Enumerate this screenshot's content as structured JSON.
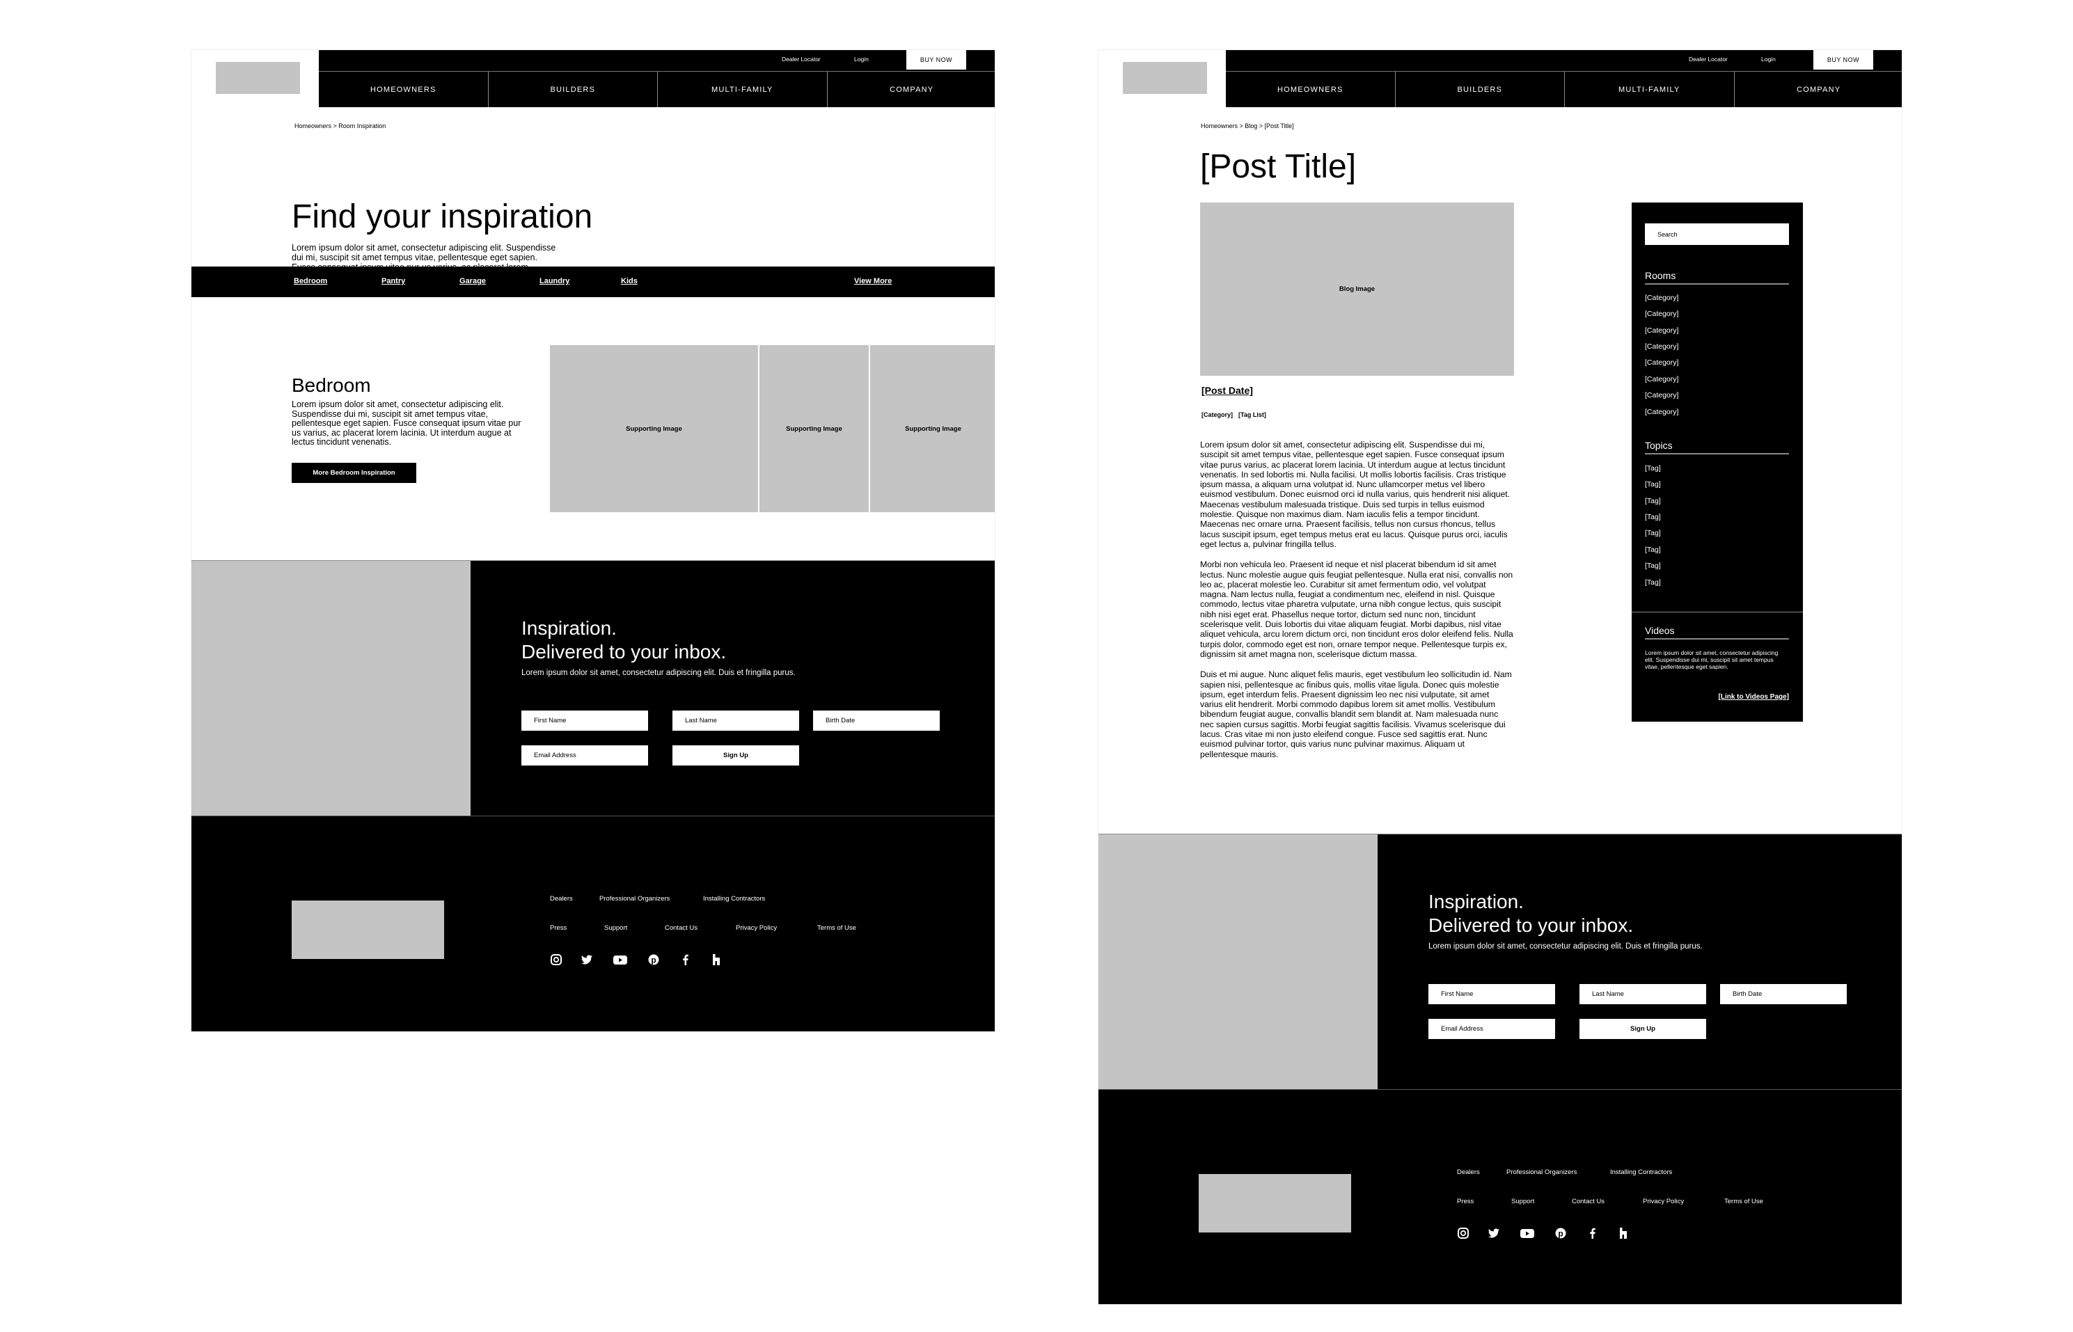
{
  "header": {
    "utility": {
      "dealer_locator": "Dealer Locator",
      "login": "Login",
      "buy_now": "BUY NOW"
    },
    "nav": [
      "HOMEOWNERS",
      "BUILDERS",
      "MULTI-FAMILY",
      "COMPANY"
    ]
  },
  "inspiration_page": {
    "breadcrumb": "Homeowners > Room Inspiration",
    "title": "Find your inspiration",
    "intro": "Lorem ipsum dolor sit amet, consectetur adipiscing elit. Suspendisse dui mi, suscipit sit amet tempus vitae, pellentesque eget sapien. Fusce consequat ipsum vitae pur us varius, ac placerat lorem lacinia. Ut interdum augue at lectus tincidunt venenatis.",
    "categories": [
      "Bedroom",
      "Pantry",
      "Garage",
      "Laundry",
      "Kids"
    ],
    "view_more": "View More",
    "section": {
      "title": "Bedroom",
      "text": "Lorem ipsum dolor sit amet, consectetur adipiscing elit. Suspendisse dui mi, suscipit sit amet tempus vitae, pellentesque eget sapien. Fusce consequat ipsum vitae pur us varius, ac placerat lorem lacinia. Ut interdum augue at lectus tincidunt venenatis.",
      "button": "More Bedroom Inspiration",
      "images": [
        "Supporting Image",
        "Supporting Image",
        "Supporting Image"
      ]
    }
  },
  "blog_page": {
    "breadcrumb": "Homeowners > Blog > [Post Title]",
    "title": "[Post Title]",
    "image_label": "Blog Image",
    "post_date": "[Post Date]",
    "category": "[Category]",
    "tag_list": "[Tag List]",
    "paragraphs": [
      "Lorem ipsum dolor sit amet, consectetur adipiscing elit. Suspendisse dui mi, suscipit sit amet tempus vitae, pellentesque eget sapien. Fusce consequat ipsum vitae purus varius, ac placerat lorem lacinia. Ut interdum augue at lectus tincidunt venenatis. In sed lobortis mi. Nulla facilisi. Ut mollis lobortis facilisis. Cras tristique ipsum massa, a aliquam urna volutpat id. Nunc ullamcorper metus vel libero euismod vestibulum. Donec euismod orci id nulla varius, quis hendrerit nisi aliquet. Maecenas vestibulum malesuada tristique. Duis sed turpis in tellus euismod molestie. Quisque non maximus diam. Nam iaculis felis a tempor tincidunt. Maecenas nec ornare urna. Praesent facilisis, tellus non cursus rhoncus, tellus lacus suscipit ipsum, eget tempus metus erat eu lacus. Quisque purus orci, iaculis eget lectus a, pulvinar fringilla tellus.",
      "Morbi non vehicula leo. Praesent id neque et nisl placerat bibendum id sit amet lectus. Nunc molestie augue quis feugiat pellentesque. Nulla erat nisi, convallis non leo ac, placerat molestie leo. Curabitur sit amet fermentum odio, vel volutpat magna. Nam lectus nulla, feugiat a condimentum nec, eleifend in nisl. Quisque commodo, lectus vitae pharetra vulputate, urna nibh congue lectus, quis suscipit nibh nisi eget erat. Phasellus neque tortor, dictum sed nunc non, tincidunt scelerisque velit. Duis lobortis dui vitae aliquam feugiat. Morbi dapibus, nisl vitae aliquet vehicula, arcu lorem dictum orci, non tincidunt eros dolor eleifend felis. Nulla turpis dolor, commodo eget est non, ornare tempor neque. Pellentesque turpis ex, dignissim sit amet magna non, scelerisque dictum massa.",
      "Duis et mi augue. Nunc aliquet felis mauris, eget vestibulum leo sollicitudin id. Nam sapien nisi, pellentesque ac finibus quis, mollis vitae ligula. Donec quis molestie ipsum, eget interdum felis. Praesent dignissim leo nec nisi vulputate, sit amet varius elit hendrerit. Morbi commodo dapibus lorem sit amet mollis. Vestibulum bibendum feugiat augue, convallis blandit sem blandit at. Nam malesuada nunc nec sapien cursus sagittis. Morbi feugiat sagittis facilisis. Vivamus scelerisque dui lacus. Cras vitae mi non justo eleifend congue. Fusce sed sagittis erat. Nunc euismod pulvinar tortor, quis varius nunc pulvinar maximus. Aliquam ut pellentesque mauris."
    ],
    "sidebar": {
      "search_placeholder": "Search",
      "rooms_title": "Rooms",
      "rooms": [
        "[Category]",
        "[Category]",
        "[Category]",
        "[Category]",
        "[Category]",
        "[Category]",
        "[Category]",
        "[Category]"
      ],
      "topics_title": "Topics",
      "topics": [
        "[Tag]",
        "[Tag]",
        "[Tag]",
        "[Tag]",
        "[Tag]",
        "[Tag]",
        "[Tag]",
        "[Tag]"
      ],
      "videos_title": "Videos",
      "videos_text": "Lorem ipsum dolor sit amet, consectetur adipiscing elit. Suspendisse dui mi, suscipit sit amet tempus vitae, pellentesque eget sapien.",
      "videos_link": "[Link to Videos Page]"
    }
  },
  "newsletter": {
    "title_line1": "Inspiration.",
    "title_line2": "Delivered to your inbox.",
    "text": "Lorem ipsum dolor sit amet, consectetur adipiscing elit. Duis et fringilla purus.",
    "first_name": "First Name",
    "last_name": "Last Name",
    "birth_date": "Birth Date",
    "email": "Email Address",
    "sign_up": "Sign Up"
  },
  "footer": {
    "links_row1": [
      "Dealers",
      "Professional Organizers",
      "Installing Contractors"
    ],
    "links_row2": [
      "Press",
      "Support",
      "Contact Us",
      "Privacy Policy",
      "Terms of Use"
    ],
    "social_icons": [
      "instagram-icon",
      "twitter-icon",
      "youtube-icon",
      "pinterest-icon",
      "facebook-icon",
      "houzz-icon"
    ]
  },
  "colors": {
    "black": "#000000",
    "placeholder_gray": "#c4c4c4",
    "white": "#ffffff"
  }
}
